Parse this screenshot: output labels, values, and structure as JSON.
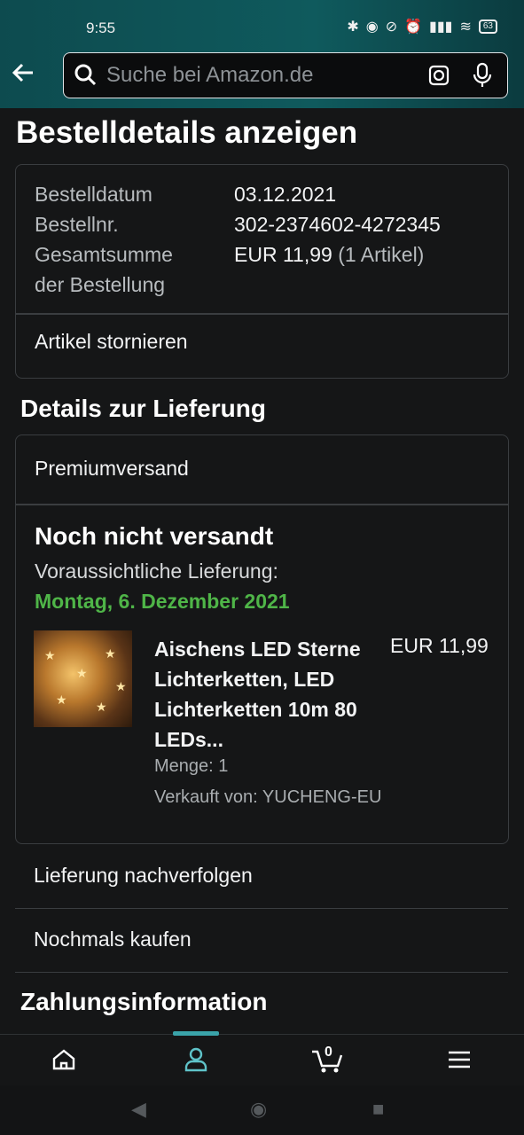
{
  "status_bar": {
    "time": "9:55",
    "battery": "63"
  },
  "search": {
    "placeholder": "Suche bei Amazon.de"
  },
  "page_title": "Bestelldetails anzeigen",
  "order_summary": {
    "date_label": "Bestelldatum",
    "date_value": "03.12.2021",
    "number_label": "Bestellnr.",
    "number_value": "302-2374602-4272345",
    "total_label_line1": "Gesamtsumme",
    "total_label_line2": "der Bestellung",
    "total_value": "EUR 11,99",
    "total_count": "(1 Artikel)",
    "cancel_label": "Artikel stornieren"
  },
  "delivery": {
    "section_title": "Details zur Lieferung",
    "shipping_method": "Premiumversand",
    "status": "Noch nicht versandt",
    "expected_label": "Voraussichtliche Lieferung:",
    "expected_date": "Montag, 6. Dezember 2021",
    "item": {
      "title": "Aischens LED Sterne Lichterketten, LED Lichterketten 10m 80 LEDs...",
      "price": "EUR 11,99",
      "quantity": "Menge: 1",
      "seller": "Verkauft von: YUCHENG-EU"
    }
  },
  "actions": {
    "track": "Lieferung nachverfolgen",
    "buy_again": "Nochmals kaufen"
  },
  "payment": {
    "section_title": "Zahlungsinformation"
  },
  "bottom_nav": {
    "cart_count": "0"
  },
  "colors": {
    "accent_green": "#4fb548",
    "header_teal": "#0f5a5d",
    "nav_indicator": "#3aa3a9"
  }
}
